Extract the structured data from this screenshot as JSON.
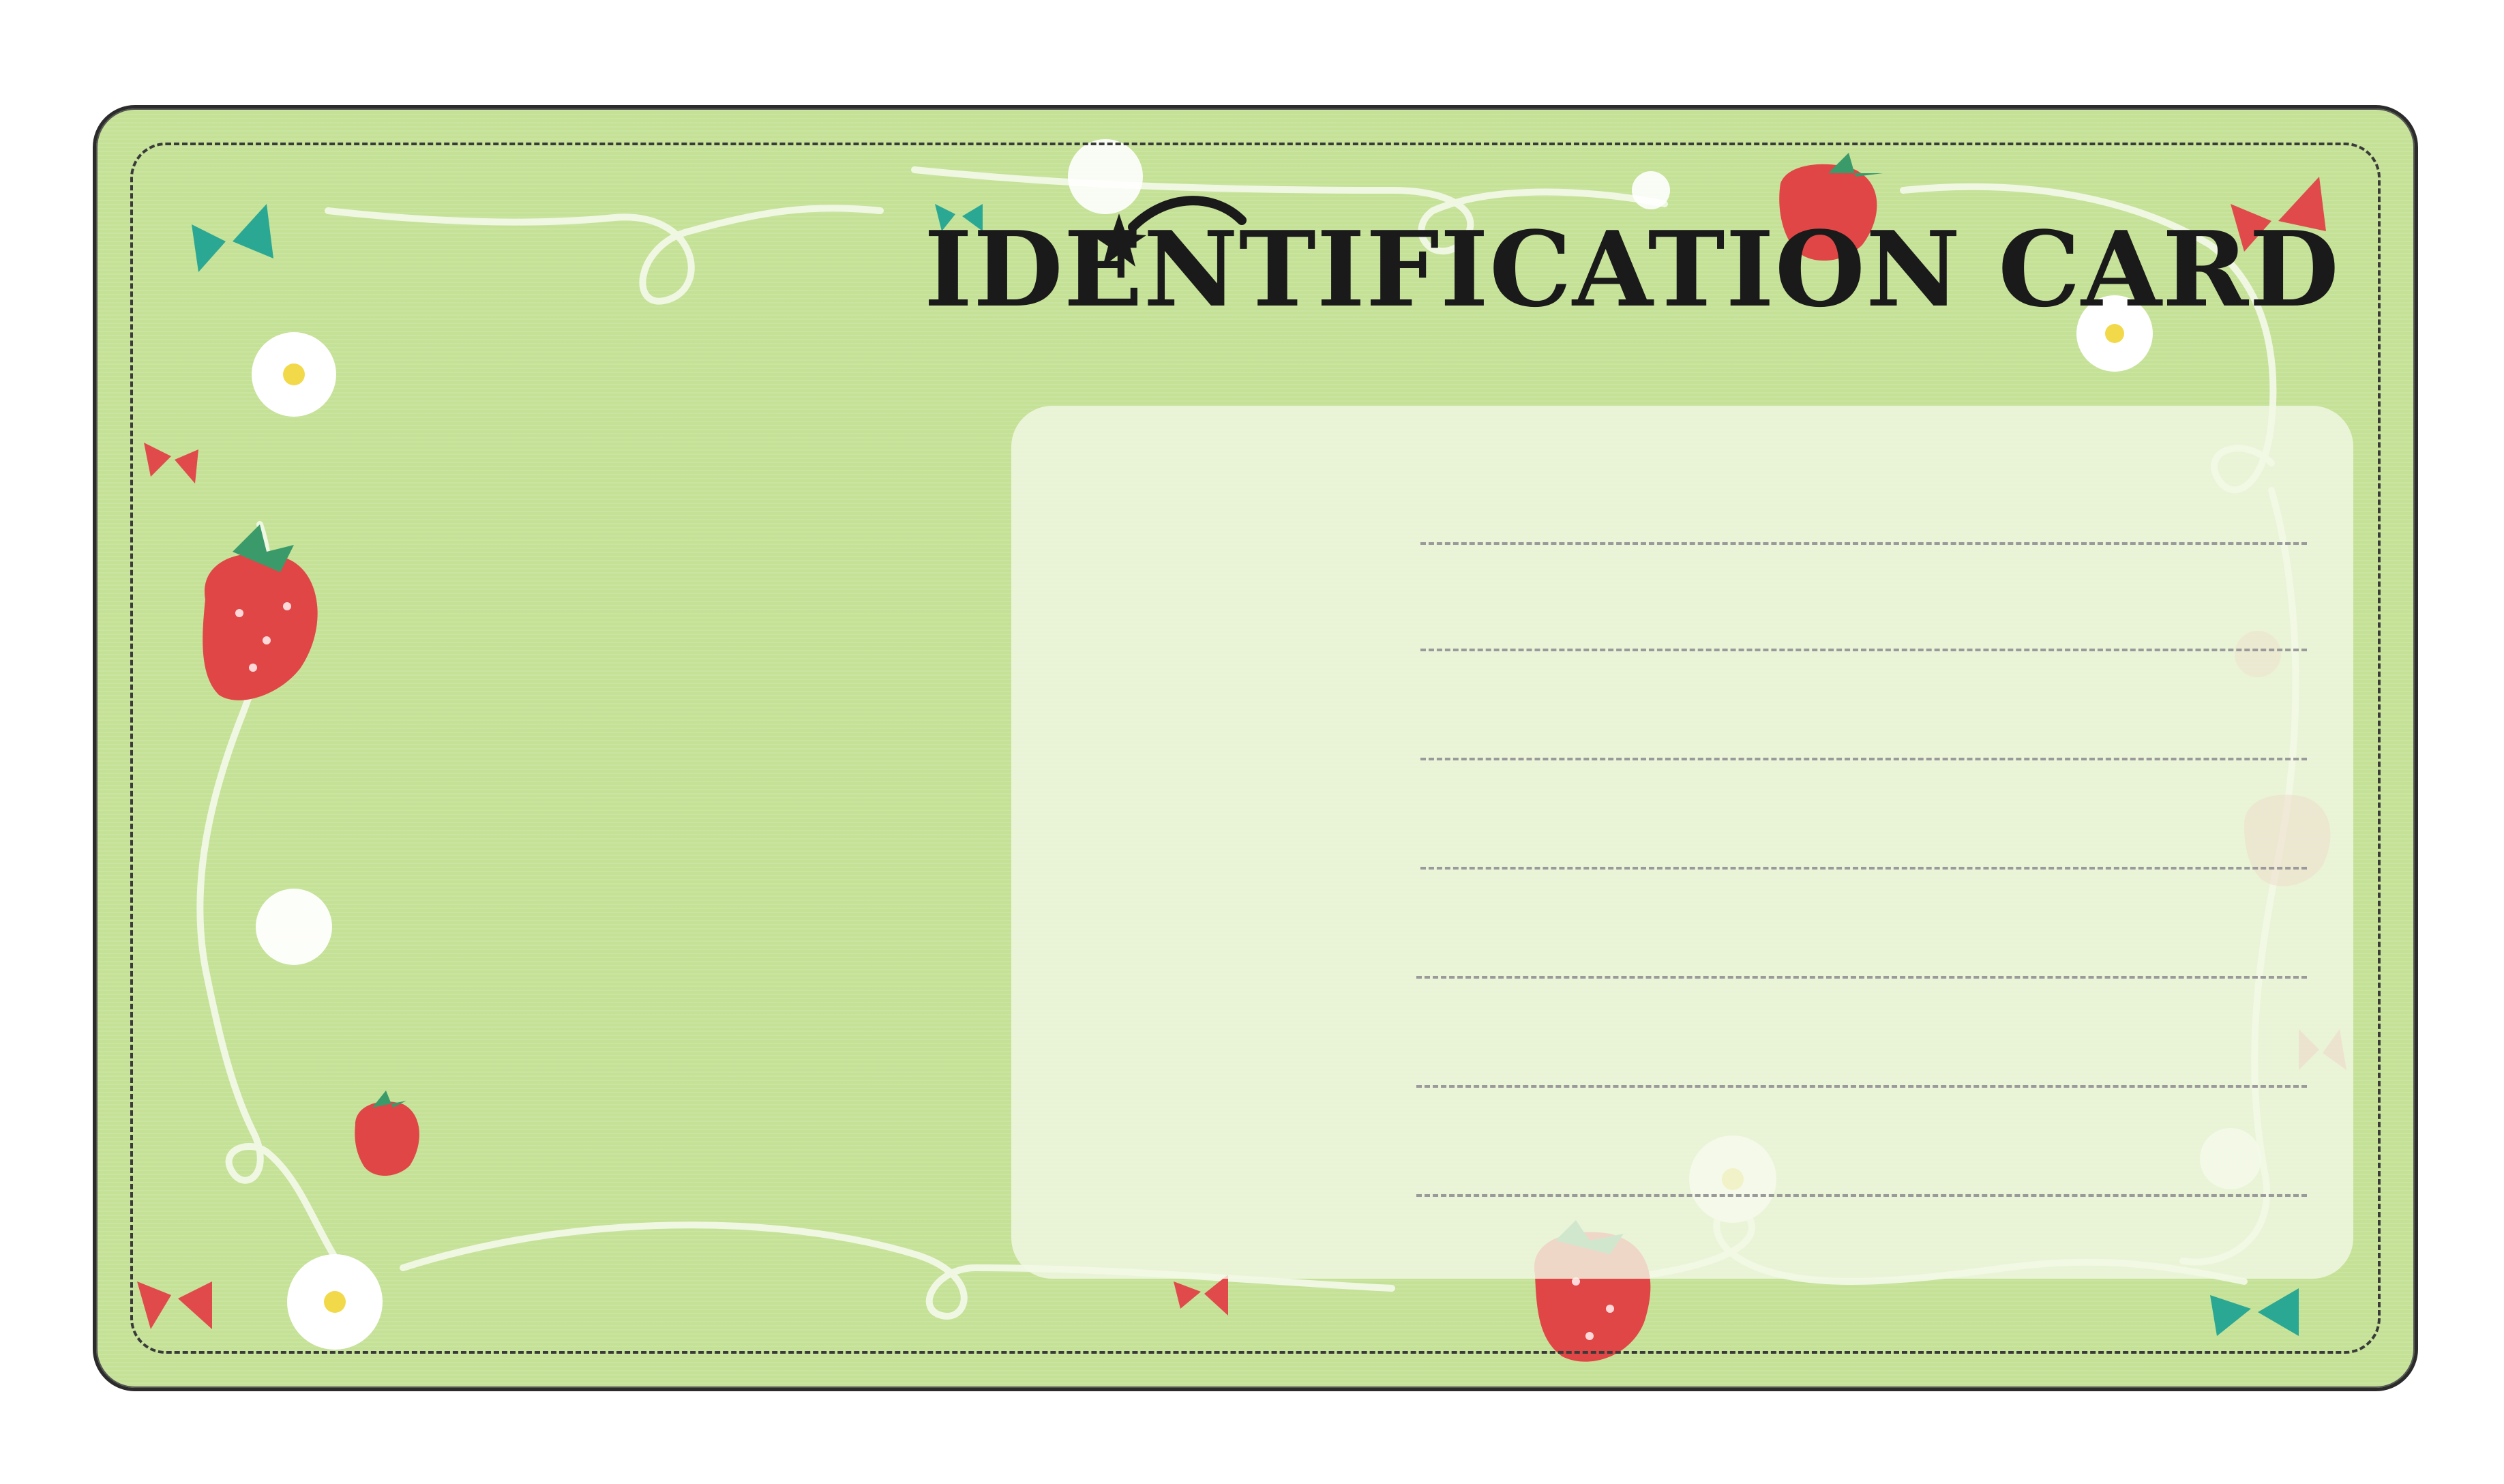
{
  "card": {
    "title": "IDENTIFICATION CARD",
    "background_color": "#c4e196",
    "panel_color": "#f1f8e4",
    "stitch_color": "#3a3a3a",
    "write_line_count": 7
  },
  "decorations": {
    "icons": [
      "strawberry-icon",
      "flower-icon",
      "ribbon-bow-icon",
      "shooting-star-icon",
      "swirl-vine"
    ],
    "accent_colors": {
      "strawberry": "#e04646",
      "bow_red": "#e04a4a",
      "bow_teal": "#2aa893",
      "flower": "#ffffff",
      "flower_center": "#f2d94a"
    }
  }
}
